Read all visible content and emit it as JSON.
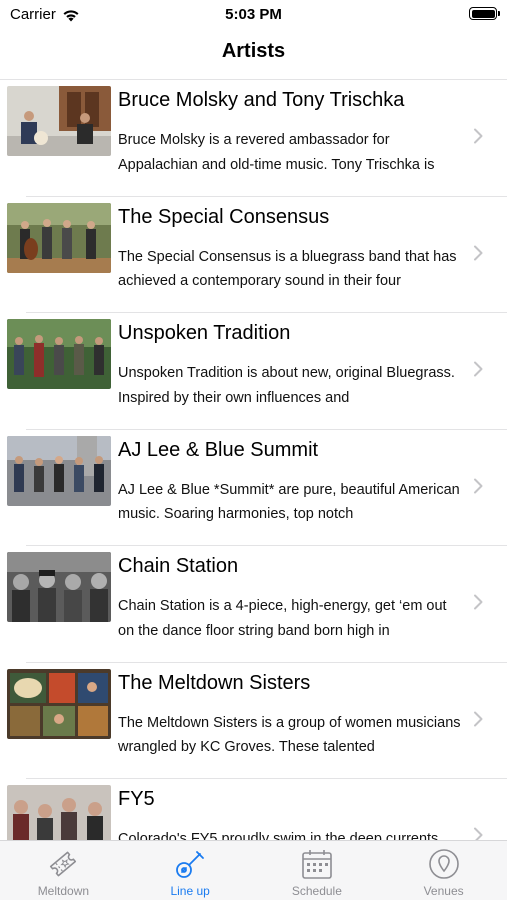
{
  "status_bar": {
    "carrier": "Carrier",
    "time": "5:03 PM"
  },
  "nav": {
    "title": "Artists"
  },
  "artists": [
    {
      "name": "Bruce Molsky and Tony Trischka",
      "description": "Bruce Molsky is a revered ambassador for Appalachian and old-time music. Tony Trischka is"
    },
    {
      "name": "The Special Consensus",
      "description": "The Special Consensus is a bluegrass band that has achieved a contemporary sound in their four"
    },
    {
      "name": "Unspoken Tradition",
      "description": "Unspoken Tradition is about new, original Bluegrass. Inspired by their own influences and"
    },
    {
      "name": "AJ Lee & Blue Summit",
      "description": "AJ Lee & Blue *Summit* are pure, beautiful American music. Soaring harmonies, top notch"
    },
    {
      "name": "Chain Station",
      "description": "Chain Station is a 4-piece, high-energy, get ‘em out on the dance floor string band born high in"
    },
    {
      "name": "The Meltdown Sisters",
      "description": "The Meltdown Sisters is a group of women musicians wrangled by KC Groves. These talented"
    },
    {
      "name": "FY5",
      "description": "Colorado's FY5 proudly swim in the deep currents"
    }
  ],
  "tabs": [
    {
      "label": "Meltdown",
      "icon": "ticket-icon",
      "active": false
    },
    {
      "label": "Line up",
      "icon": "guitar-icon",
      "active": true
    },
    {
      "label": "Schedule",
      "icon": "calendar-icon",
      "active": false
    },
    {
      "label": "Venues",
      "icon": "location-pin-icon",
      "active": false
    }
  ],
  "colors": {
    "accent": "#1a7bf0",
    "inactive_tab": "#8e8e93",
    "separator": "#e3e3e5",
    "chevron": "#c4c4c7"
  }
}
